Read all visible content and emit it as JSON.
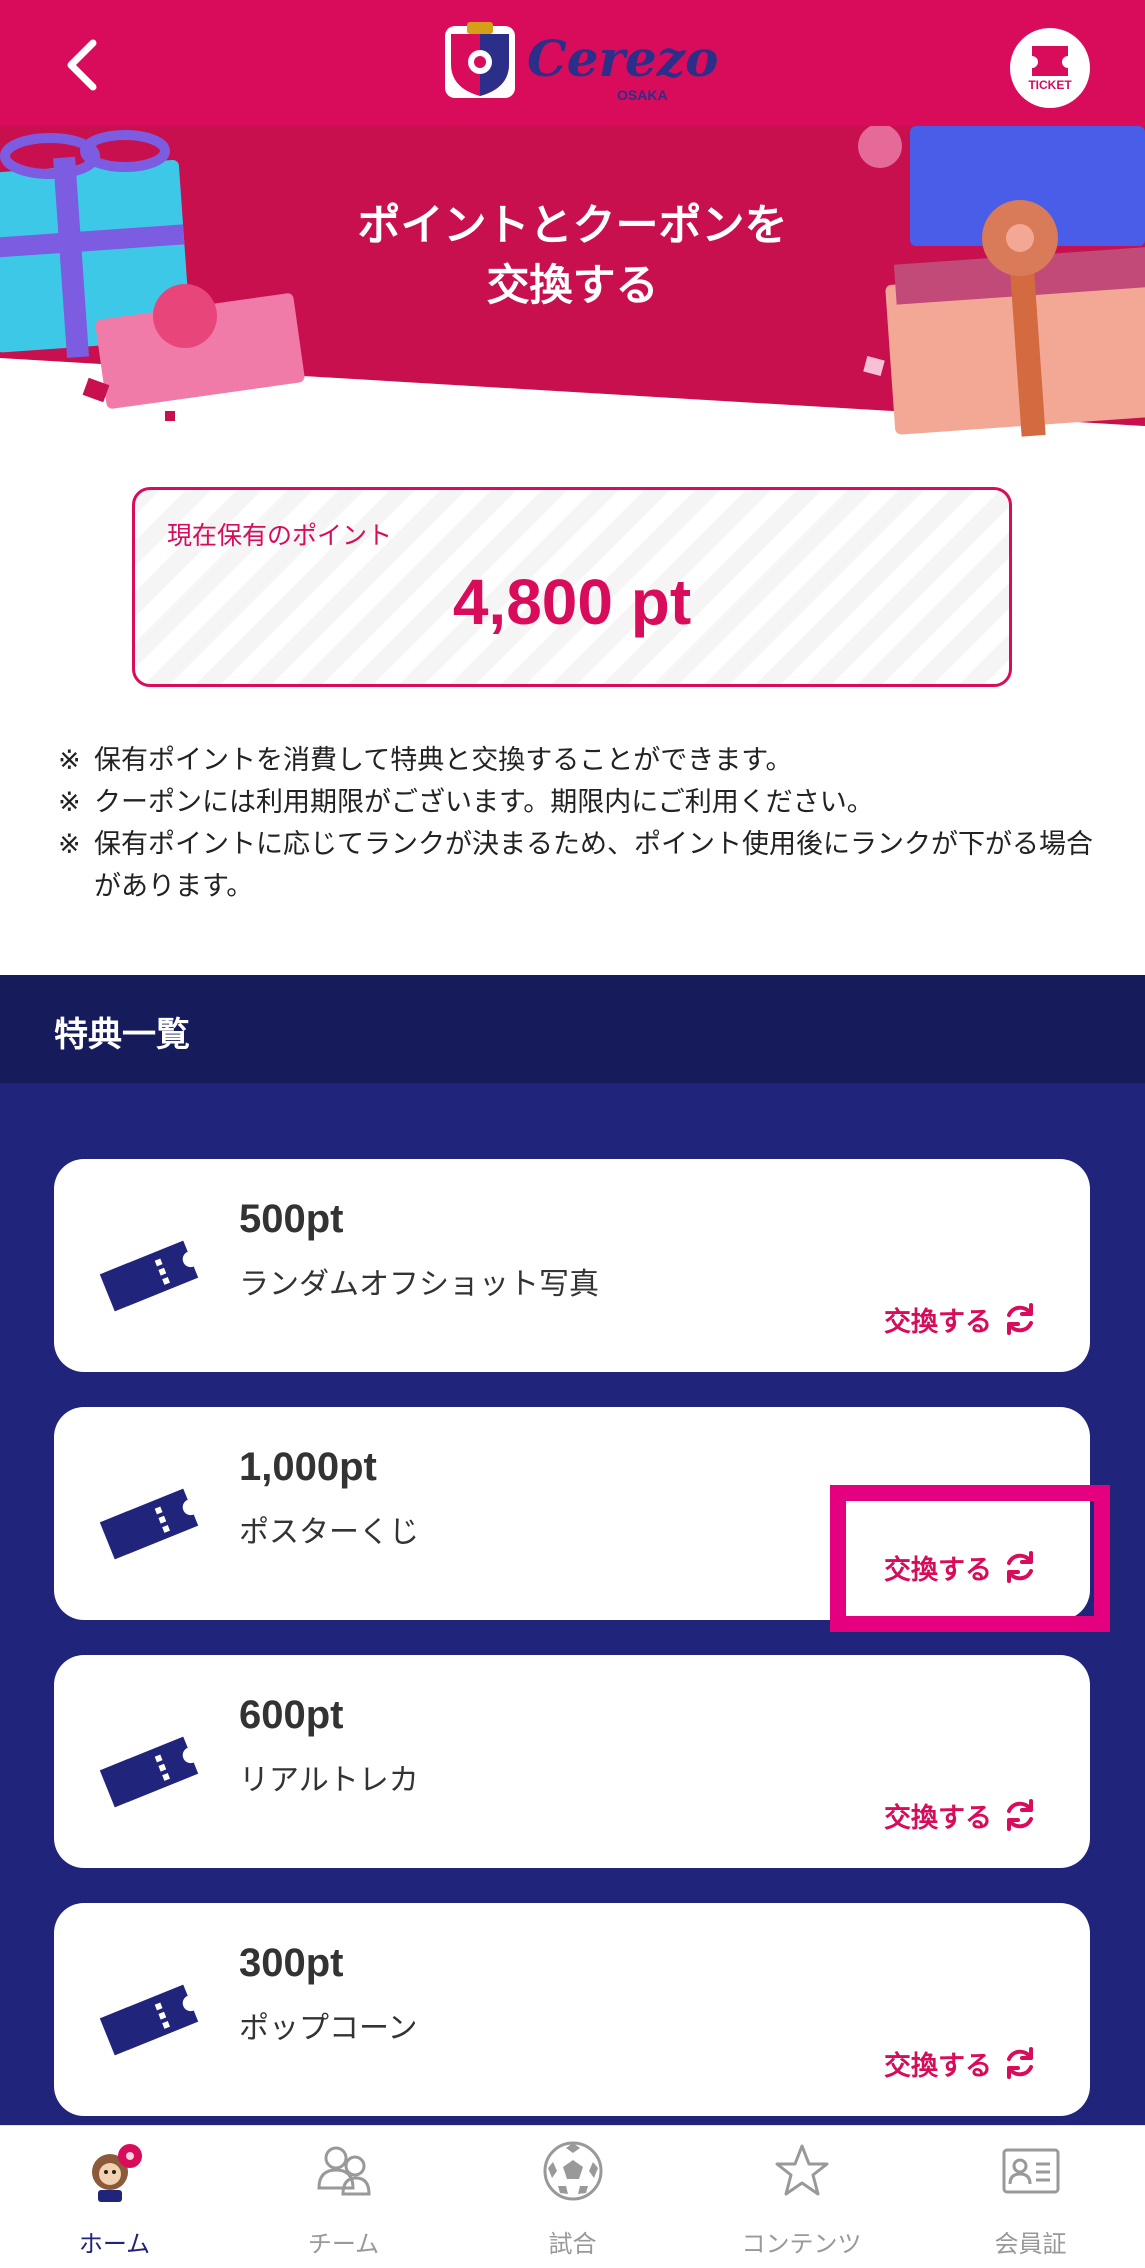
{
  "header": {
    "logo_text": "Cerezo",
    "logo_subtext": "OSAKA",
    "ticket_label": "TICKET"
  },
  "banner": {
    "title": "ポイントとクーポンを\n交換する"
  },
  "points": {
    "label": "現在保有のポイント",
    "value": "4,800 pt"
  },
  "notes": [
    "保有ポイントを消費して特典と交換することができます。",
    "クーポンには利用期限がございます。期限内にご利用ください。",
    "保有ポイントに応じてランクが決まるため、ポイント使用後にランクが下がる場合があります。"
  ],
  "note_mark": "※",
  "section": {
    "title": "特典一覧"
  },
  "items": [
    {
      "points": "500pt",
      "name": "ランダムオフショット写真",
      "action": "交換する"
    },
    {
      "points": "1,000pt",
      "name": "ポスターくじ",
      "action": "交換する"
    },
    {
      "points": "600pt",
      "name": "リアルトレカ",
      "action": "交換する"
    },
    {
      "points": "300pt",
      "name": "ポップコーン",
      "action": "交換する"
    }
  ],
  "nav": [
    {
      "label": "ホーム",
      "icon": "mascot-icon",
      "active": true
    },
    {
      "label": "チーム",
      "icon": "team-icon",
      "active": false
    },
    {
      "label": "試合",
      "icon": "soccer-ball-icon",
      "active": false
    },
    {
      "label": "コンテンツ",
      "icon": "star-icon",
      "active": false
    },
    {
      "label": "会員証",
      "icon": "member-card-icon",
      "active": false
    }
  ],
  "colors": {
    "primary": "#d80c5a",
    "navy": "#20247a",
    "navy_dark": "#161b5c",
    "highlight": "#e4007f"
  }
}
